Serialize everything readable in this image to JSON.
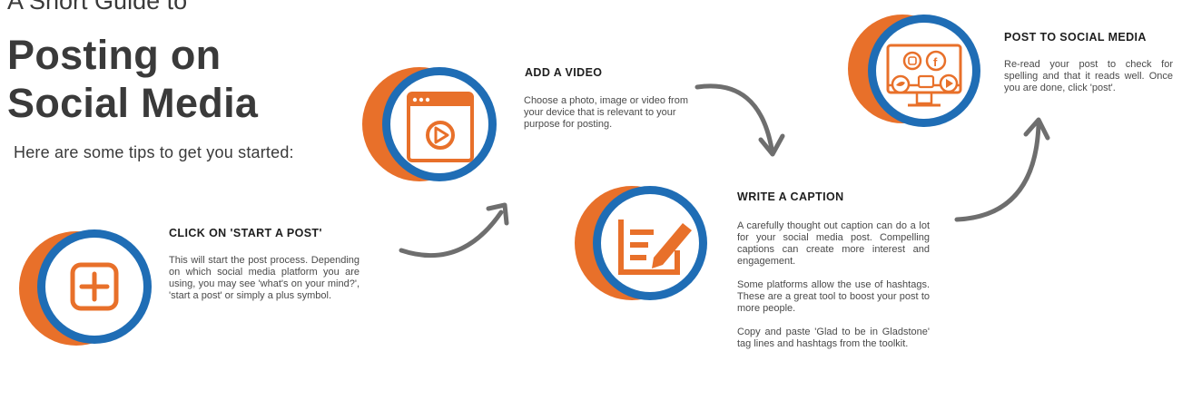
{
  "guide": {
    "subtitle": "A Short Guide to",
    "title_line1": "Posting on",
    "title_line2": "Social Media",
    "intro": "Here are some tips to get you started:"
  },
  "steps": [
    {
      "heading": "CLICK ON 'START A POST'",
      "paragraphs": [
        "This will start the post process. Depending on which social media platform you are using, you may see 'what's on your mind?', 'start a post' or simply a plus symbol."
      ],
      "icon": "plus-icon"
    },
    {
      "heading": "ADD A VIDEO",
      "paragraphs": [
        "Choose a photo, image or video from your device that is relevant to your purpose for posting."
      ],
      "icon": "video-window-icon"
    },
    {
      "heading": "WRITE A CAPTION",
      "paragraphs": [
        "A carefully thought out caption can do a lot for your social media post. Compelling captions can create more interest and engagement.",
        "Some platforms allow the use of hashtags. These are a great tool to boost your post to more people.",
        "Copy and paste 'Glad to be in Gladstone' tag lines and hashtags from the toolkit."
      ],
      "icon": "edit-document-icon"
    },
    {
      "heading": "POST TO SOCIAL MEDIA",
      "paragraphs": [
        "Re-read your post to check for spelling and that it reads well. Once you are done, click 'post'."
      ],
      "icon": "social-media-monitor-icon"
    }
  ],
  "colors": {
    "orange": "#e8702a",
    "blue": "#1f6db5",
    "arrow": "#6e6e6e",
    "text": "#3a3a3a"
  }
}
